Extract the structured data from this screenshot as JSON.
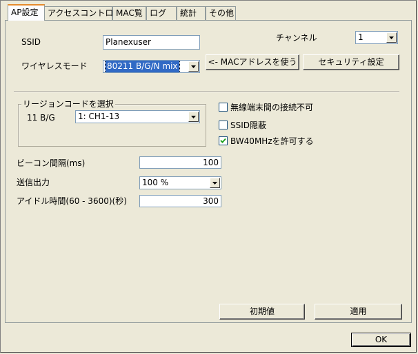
{
  "tabs": [
    {
      "label": "AP設定",
      "active": true
    },
    {
      "label": "アクセスコントロール"
    },
    {
      "label": "MAC覧"
    },
    {
      "label": "ログ"
    },
    {
      "label": "統計"
    },
    {
      "label": "その他"
    }
  ],
  "ssid": {
    "label": "SSID",
    "value": "Planexuser"
  },
  "channel": {
    "label": "チャンネル",
    "value": "1"
  },
  "wireless_mode": {
    "label": "ワイヤレスモード",
    "value": "80211 B/G/N mix"
  },
  "buttons": {
    "use_mac": "<- MACアドレスを使う",
    "security": "セキュリティ設定",
    "defaults": "初期値",
    "apply": "適用",
    "ok": "OK"
  },
  "region": {
    "legend": "リージョンコードを選択",
    "band_label": "11 B/G",
    "value": "1: CH1-13"
  },
  "options": {
    "no_client_link": {
      "label": "無線端末間の接続不可",
      "checked": false
    },
    "ssid_hidden": {
      "label": "SSID隠蔽",
      "checked": false
    },
    "bw40": {
      "label": "BW40MHzを許可する",
      "checked": true
    }
  },
  "beacon": {
    "label": "ビーコン間隔(ms)",
    "value": "100"
  },
  "tx_power": {
    "label": "送信出力",
    "value": "100 %"
  },
  "idle_time": {
    "label": "アイドル時間(60 - 3600)(秒)",
    "value": "300"
  }
}
